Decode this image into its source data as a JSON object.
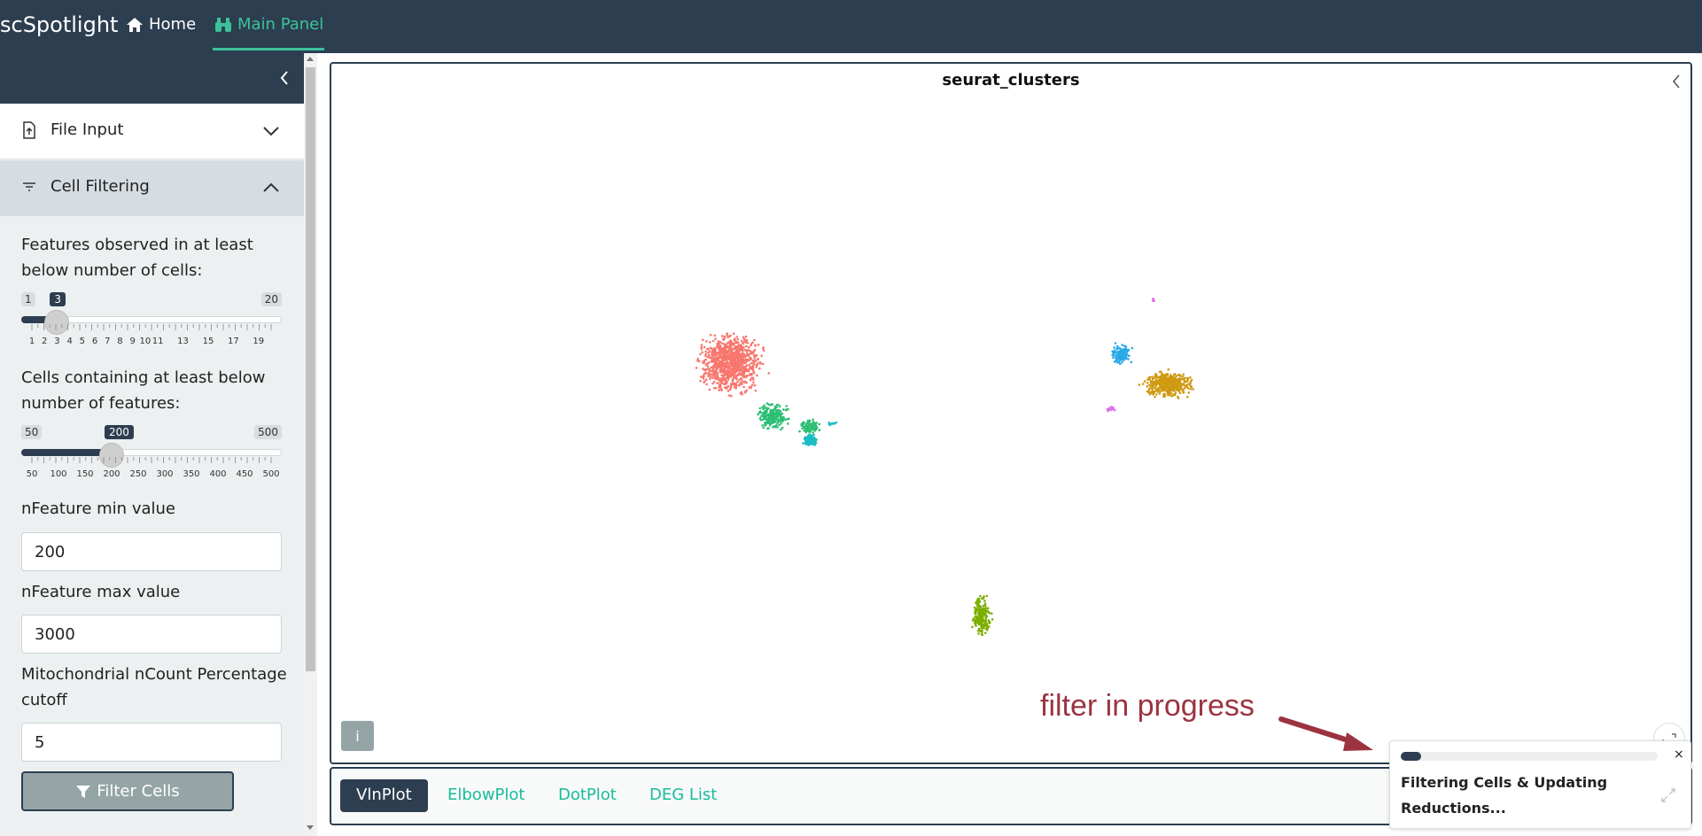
{
  "navbar": {
    "brand": "scSpotlight",
    "home_label": "Home",
    "main_panel_label": "Main Panel",
    "accent": "#3cc29b",
    "background": "#2c3e50"
  },
  "sidebar": {
    "accordion": {
      "file_input_label": "File Input",
      "cell_filtering_label": "Cell Filtering"
    },
    "features_label": "Features observed in at least below number of cells:",
    "features_slider": {
      "min": "1",
      "max": "20",
      "value": "3",
      "value_num": 3,
      "min_num": 1,
      "max_num": 20,
      "ticks": [
        "1",
        "2",
        "3",
        "4",
        "5",
        "6",
        "7",
        "8",
        "9",
        "10",
        "11",
        "13",
        "15",
        "17",
        "19"
      ]
    },
    "cells_label": "Cells containing at least below number of features:",
    "cells_slider": {
      "min": "50",
      "max": "500",
      "value": "200",
      "value_num": 200,
      "min_num": 50,
      "max_num": 500,
      "ticks": [
        "50",
        "100",
        "150",
        "200",
        "250",
        "300",
        "350",
        "400",
        "450",
        "500"
      ]
    },
    "nfeature_min_label": "nFeature min value",
    "nfeature_min_value": "200",
    "nfeature_max_label": "nFeature max value",
    "nfeature_max_value": "3000",
    "mito_label": "Mitochondrial nCount Percentage cutoff",
    "mito_value": "5",
    "filter_button_label": "Filter Cells"
  },
  "plot": {
    "title": "seurat_clusters",
    "info_label": "i",
    "cluster_colors": [
      "#f8766d",
      "#2cbe74",
      "#1cbdc4",
      "#2aa8e8",
      "#cf9a12",
      "#7cae00",
      "#e06fe8"
    ]
  },
  "annotation": {
    "text": "filter in progress",
    "color": "#9b3440"
  },
  "tabs": [
    {
      "label": "VlnPlot",
      "active": true
    },
    {
      "label": "ElbowPlot",
      "active": false
    },
    {
      "label": "DotPlot",
      "active": false
    },
    {
      "label": "DEG List",
      "active": false
    }
  ],
  "notification": {
    "text": "Filtering Cells & Updating Reductions...",
    "progress": 0.08,
    "close_label": "×"
  }
}
